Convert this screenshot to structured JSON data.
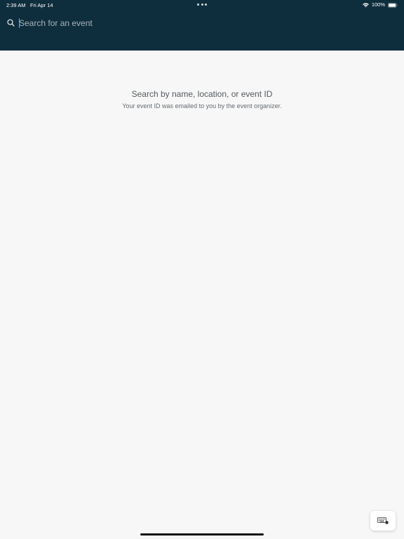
{
  "status_bar": {
    "time": "2:39 AM",
    "date": "Fri Apr 14",
    "battery_percent": "100%",
    "icons": [
      "wifi-icon",
      "battery-icon"
    ]
  },
  "header": {
    "background_color": "#0f2e3d",
    "search": {
      "placeholder": "Search for an event",
      "value": "",
      "icon": "search-icon"
    }
  },
  "empty_state": {
    "title": "Search by name, location, or event ID",
    "subtitle": "Your event ID was emailed to you by the event organizer."
  },
  "floating": {
    "keyboard_button_icon": "keyboard-icon"
  },
  "colors": {
    "header": "#0f2e3d",
    "page_background": "#f7f7f7",
    "caret": "#5aa8ff"
  }
}
